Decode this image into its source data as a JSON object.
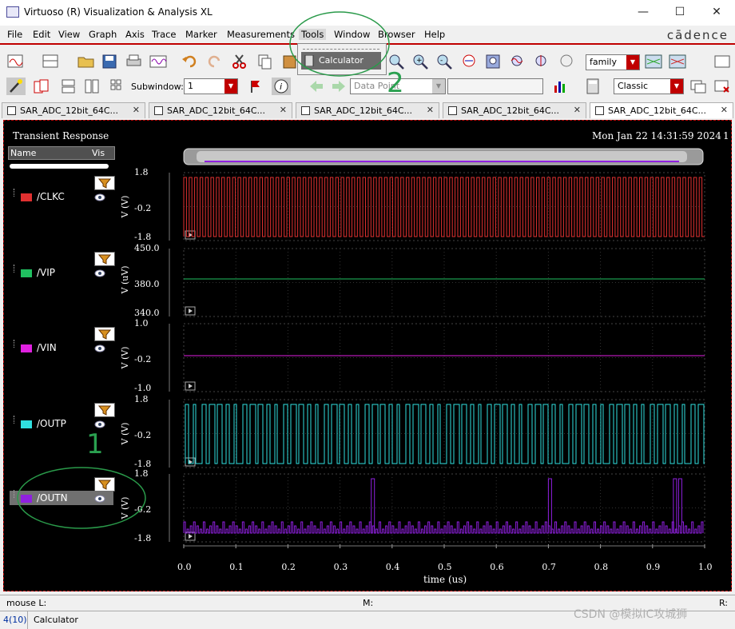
{
  "window": {
    "title": "Virtuoso (R) Visualization & Analysis XL"
  },
  "menubar": {
    "items": [
      "File",
      "Edit",
      "View",
      "Graph",
      "Axis",
      "Trace",
      "Marker",
      "Measurements",
      "Tools",
      "Window",
      "Browser",
      "Help"
    ],
    "brand": "cādence"
  },
  "tools_menu": {
    "item": "Calculator"
  },
  "toolbar1": {
    "font_combo": "family"
  },
  "toolbar2": {
    "subwindow_label": "Subwindow:",
    "subwindow_value": "1",
    "data_point_placeholder": "Data Point",
    "style_combo": "Classic"
  },
  "tabs": [
    "SAR_ADC_12bit_64C...",
    "SAR_ADC_12bit_64C...",
    "SAR_ADC_12bit_64C...",
    "SAR_ADC_12bit_64C...",
    "SAR_ADC_12bit_64C..."
  ],
  "plot": {
    "title": "Transient Response",
    "timestamp": "Mon Jan 22 14:31:59 2024",
    "page_num": "1",
    "name_header": "Name",
    "vis_header": "Vis",
    "xlabel": "time (us)"
  },
  "signals": [
    {
      "name": "/CLKC",
      "color": "#e03030",
      "ylabel": "V (V)",
      "yticks": [
        "1.8",
        "-0.2",
        "-1.8"
      ]
    },
    {
      "name": "/VIP",
      "color": "#20c060",
      "ylabel": "V (uV)",
      "yticks": [
        "450.0",
        "380.0",
        "340.0"
      ]
    },
    {
      "name": "/VIN",
      "color": "#e020e0",
      "ylabel": "V (V)",
      "yticks": [
        "1.0",
        "-0.2",
        "-1.0"
      ]
    },
    {
      "name": "/OUTP",
      "color": "#30e0e0",
      "ylabel": "V (V)",
      "yticks": [
        "1.8",
        "-0.2",
        "-1.8"
      ]
    },
    {
      "name": "/OUTN",
      "color": "#9020e0",
      "ylabel": "V (V)",
      "yticks": [
        "1.8",
        "-0.2",
        "-1.8"
      ]
    }
  ],
  "xaxis": {
    "ticks": [
      "0.0",
      "0.1",
      "0.2",
      "0.3",
      "0.4",
      "0.5",
      "0.6",
      "0.7",
      "0.8",
      "0.9",
      "1.0"
    ]
  },
  "annotations": {
    "one": "1",
    "two": "2"
  },
  "status": {
    "mouse": "mouse L:",
    "middle": "M:",
    "right": "R:",
    "count": "4(10)",
    "cmd": "Calculator"
  },
  "watermark": "CSDN @模拟IC攻城狮"
}
